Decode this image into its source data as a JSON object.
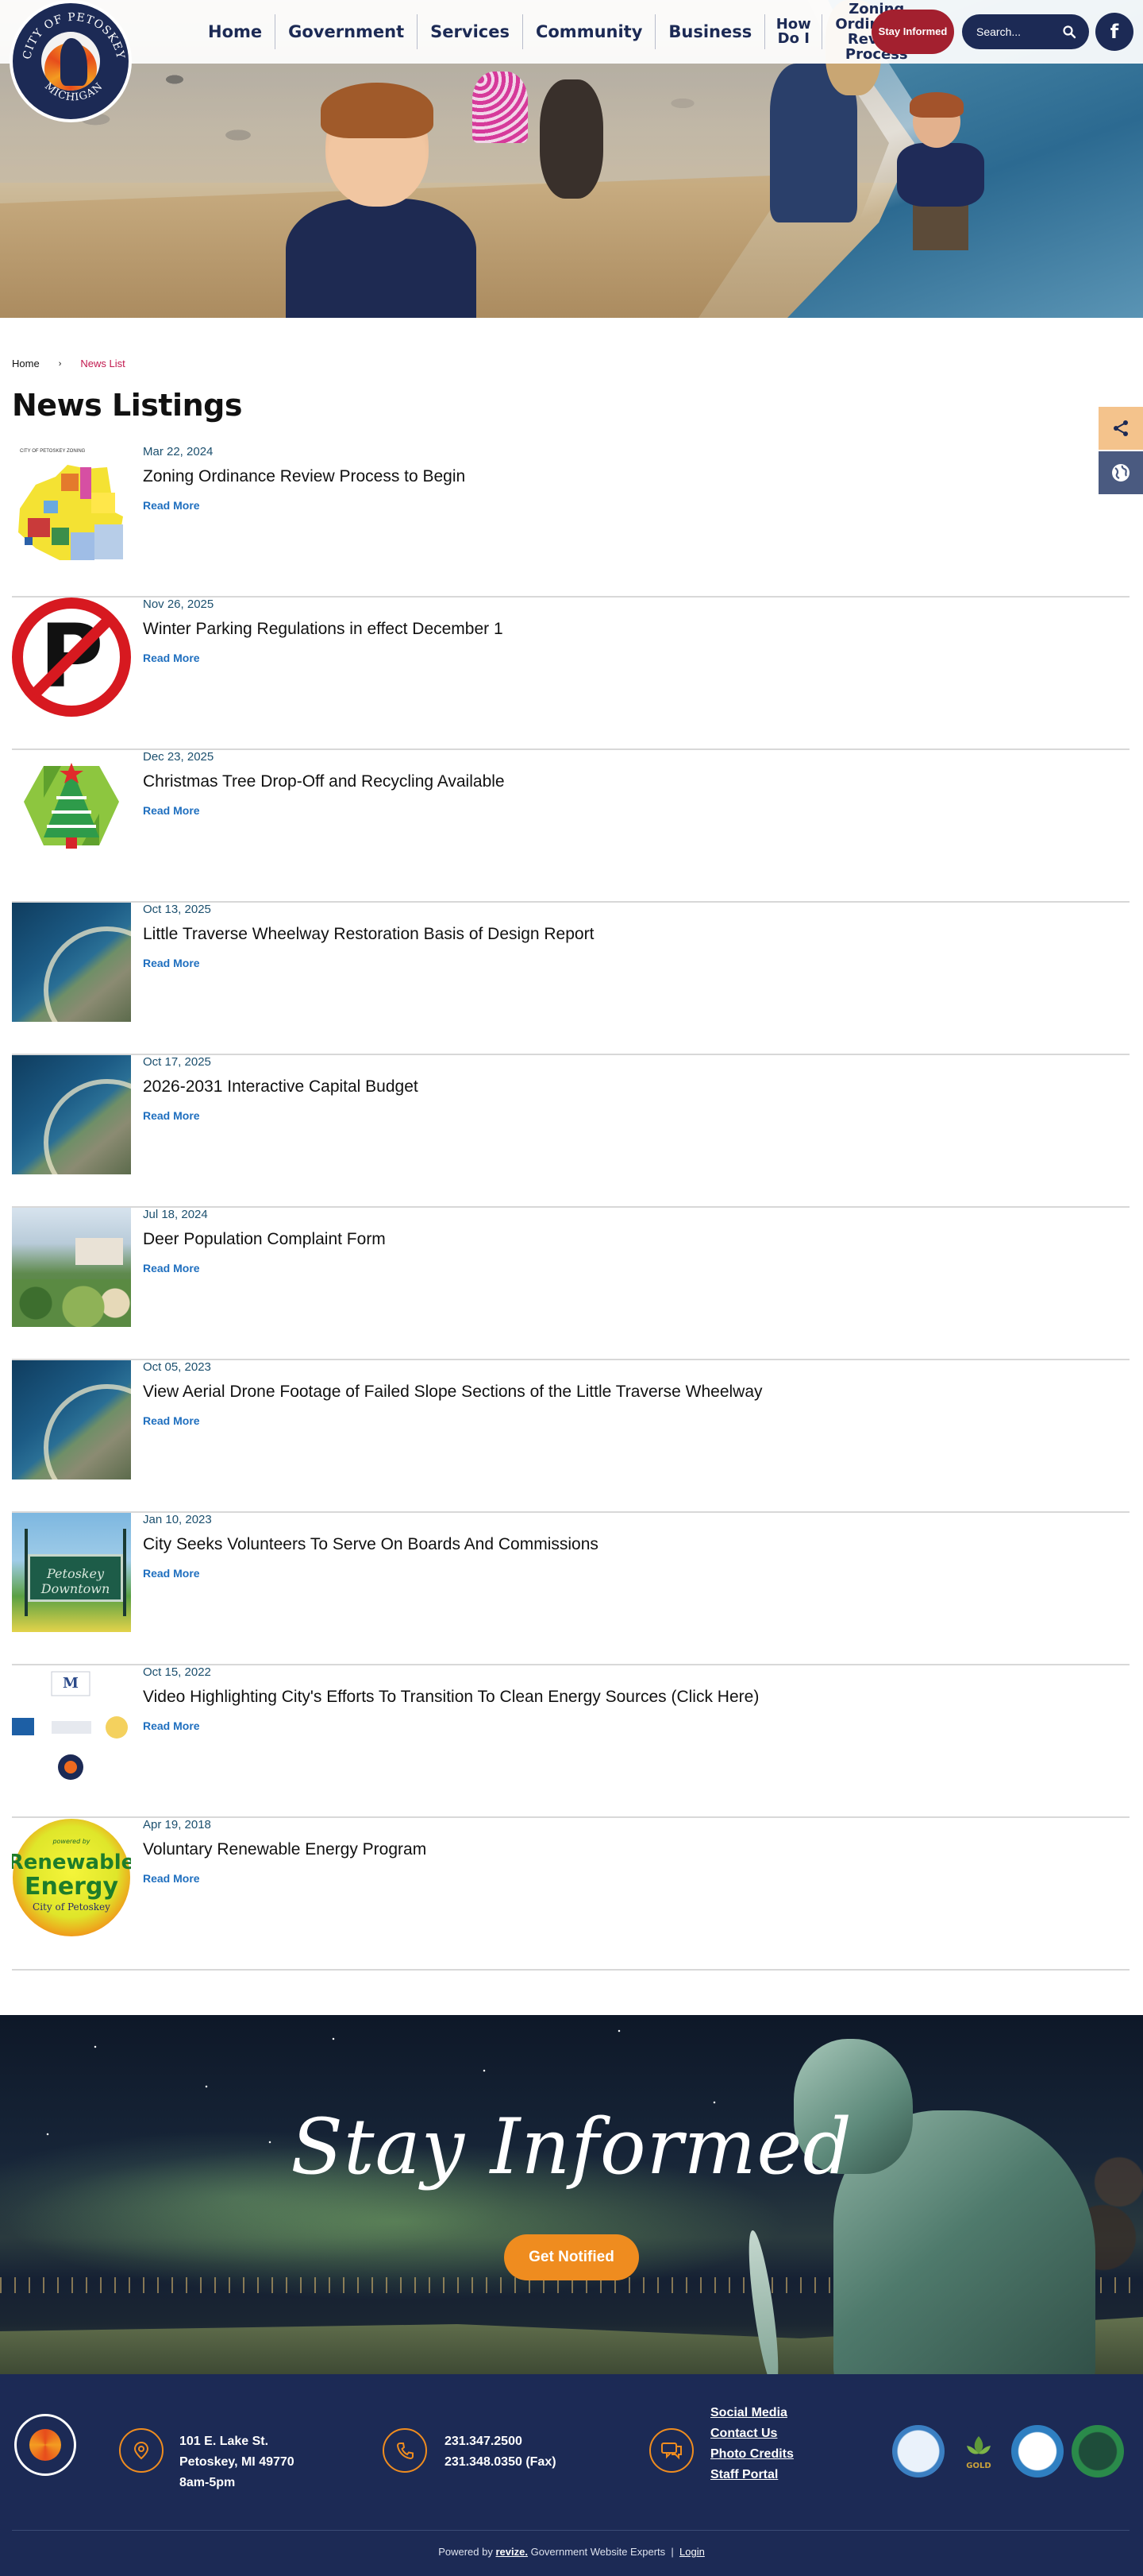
{
  "logo": {
    "name": "City of Petoskey Michigan",
    "top_text": "CITY OF PETOSKEY",
    "bottom_text": "MICHIGAN"
  },
  "nav": {
    "items": [
      "Home",
      "Government",
      "Services",
      "Community",
      "Business"
    ],
    "how_do_i": "How Do I",
    "zoning": "Zoning Ordinance Review Process",
    "stay_informed": "Stay Informed",
    "search_placeholder": "Search...",
    "facebook": "f"
  },
  "breadcrumb": {
    "home": "Home",
    "separator": "›",
    "current": "News List"
  },
  "page_title": "News Listings",
  "news": [
    {
      "date": "Mar 22, 2024",
      "title": "Zoning Ordinance Review Process to Begin",
      "link": "Read More",
      "thumb": "zoning-map",
      "thumb_caption": "CITY OF PETOSKEY ZONING"
    },
    {
      "date": "Nov 26, 2025",
      "title": "Winter Parking Regulations in effect December 1",
      "link": "Read More",
      "thumb": "no-parking"
    },
    {
      "date": "Dec 23, 2025",
      "title": "Christmas Tree Drop-Off and Recycling Available",
      "link": "Read More",
      "thumb": "christmas-tree-recycling"
    },
    {
      "date": "Oct 13, 2025",
      "title": "Little Traverse Wheelway Restoration Basis of Design Report",
      "link": "Read More",
      "thumb": "aerial-shoreline"
    },
    {
      "date": "Oct 17, 2025",
      "title": "2026-2031 Interactive Capital Budget",
      "link": "Read More",
      "thumb": "aerial-shoreline"
    },
    {
      "date": "Jul 18, 2024",
      "title": "Deer Population Complaint Form",
      "link": "Read More",
      "thumb": "yard-garden"
    },
    {
      "date": "Oct 05, 2023",
      "title": "View Aerial Drone Footage of Failed Slope Sections of the Little Traverse Wheelway",
      "link": "Read More",
      "thumb": "aerial-shoreline"
    },
    {
      "date": "Jan 10, 2023",
      "title": "City Seeks Volunteers To Serve On Boards And Commissions",
      "link": "Read More",
      "thumb": "downtown-sign",
      "thumb_text": "Petoskey Downtown"
    },
    {
      "date": "Oct 15, 2022",
      "title": "Video Highlighting City's Efforts To Transition To Clean Energy Sources (Click Here)",
      "link": "Read More",
      "thumb": "partner-logos"
    },
    {
      "date": "Apr 19, 2018",
      "title": "Voluntary Renewable Energy Program",
      "link": "Read More",
      "thumb": "renewable-energy",
      "thumb_lines": [
        "powered by",
        "Renewable",
        "Energy",
        "City of Petoskey"
      ]
    }
  ],
  "stay_informed": {
    "heading": "Stay Informed",
    "button": "Get Notified"
  },
  "footer": {
    "address": [
      "101 E. Lake St.",
      "Petoskey, MI 49770",
      "8am-5pm"
    ],
    "phones": [
      "231.347.2500",
      "231.348.0350 (Fax)"
    ],
    "links": [
      "Social Media",
      "Contact Us",
      "Photo Credits",
      "Staff Portal"
    ],
    "badges": [
      "community-badge",
      "green-community-gold",
      "tree-city-badge",
      "tree-city-usa"
    ],
    "badge_label": "GOLD",
    "powered_by": "Powered by",
    "revize": "revize.",
    "tagline": "Government Website Experts",
    "pipe": "|",
    "login": "Login"
  },
  "colors": {
    "navy": "#1c2a55",
    "accent_red": "#a3202f",
    "orange": "#ef8c1f",
    "link_blue": "#1f6fbf",
    "breadcrumb_current": "#c2184e"
  }
}
